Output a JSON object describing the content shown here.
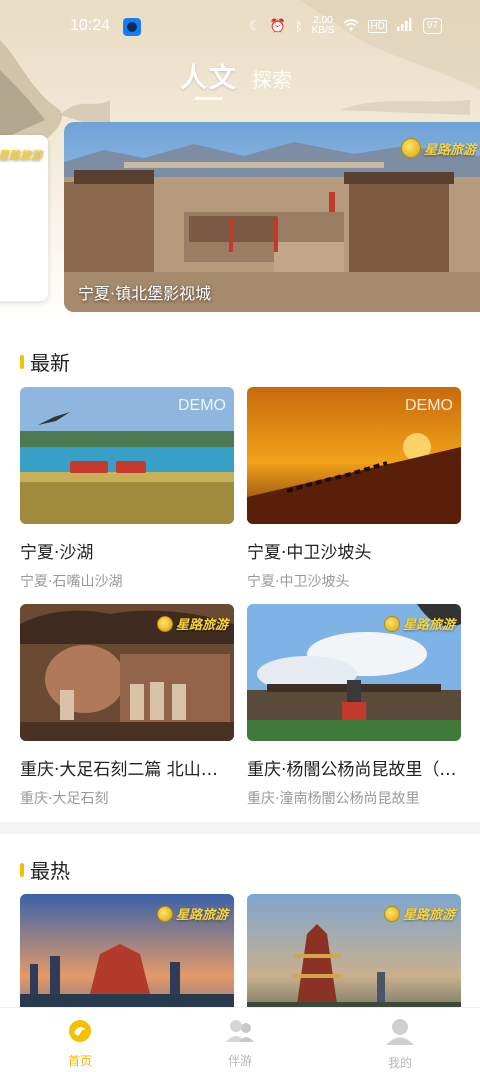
{
  "status_bar": {
    "time": "10:24",
    "speed": "2.00\nKB/S",
    "battery": "97"
  },
  "top_tabs": {
    "active": "人文",
    "inactive": "探索"
  },
  "brand": {
    "logo_text": "星路旅游"
  },
  "banner": {
    "caption": "宁夏·镇北堡影视城"
  },
  "sections": {
    "latest_title": "最新",
    "hot_title": "最热"
  },
  "latest_cards": [
    {
      "title": "宁夏·沙湖",
      "subtitle": "宁夏·石嘴山沙湖",
      "badge": "DEMO"
    },
    {
      "title": "宁夏·中卫沙坡头",
      "subtitle": "宁夏·中卫沙坡头",
      "badge": "DEMO"
    },
    {
      "title": " 重庆·大足石刻二篇 北山石刻",
      "subtitle": "重庆·大足石刻"
    },
    {
      "title": "重庆·杨闇公杨尚昆故里（潼南）",
      "subtitle": "重庆·潼南杨闇公杨尚昆故里"
    }
  ],
  "bottom_nav": [
    {
      "label": "首页",
      "icon": "home-icon",
      "active": true
    },
    {
      "label": "伴游",
      "icon": "companion-icon",
      "active": false
    },
    {
      "label": "我的",
      "icon": "profile-icon",
      "active": false
    }
  ],
  "colors": {
    "accent": "#f0b400",
    "section_bar": "#f5c000"
  }
}
